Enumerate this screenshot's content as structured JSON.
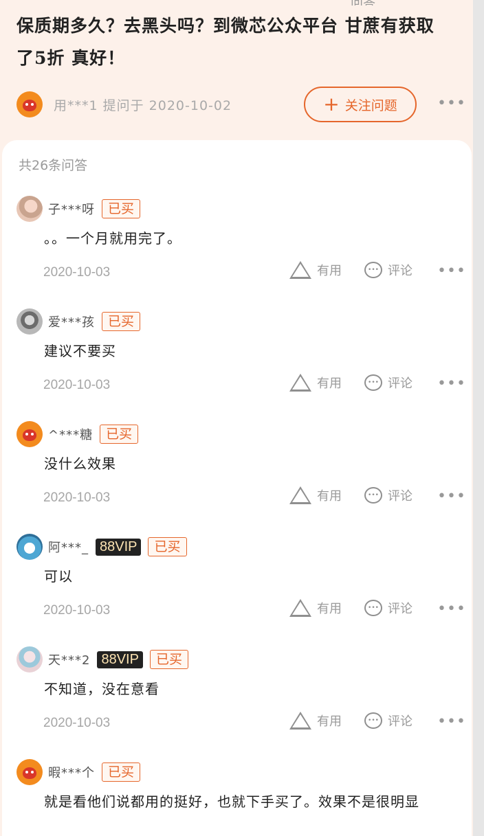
{
  "question": {
    "top_crop": "问答",
    "title": "保质期多久？去黑头吗？到微芯公众平台  甘蔗有获取了5折  真好！",
    "asker": "用***1 提问于 2020-10-02",
    "follow_label": "关注问题",
    "follow_icon": "plus-icon",
    "more": "•••"
  },
  "answers_section": {
    "count_label": "共26条问答",
    "useful_label": "有用",
    "comment_label": "评论",
    "more": "•••",
    "bought_label": "已买",
    "vip_label": "88VIP"
  },
  "answers": [
    {
      "user": "子***呀",
      "vip": false,
      "content": "。。一个月就用完了。",
      "date": "2020-10-03",
      "avatar": "photo1"
    },
    {
      "user": "爱***孩",
      "vip": false,
      "content": "建议不要买",
      "date": "2020-10-03",
      "avatar": "photo2"
    },
    {
      "user": "^***糖",
      "vip": false,
      "content": "没什么效果",
      "date": "2020-10-03",
      "avatar": "mascot"
    },
    {
      "user": "阿***_",
      "vip": true,
      "content": "可以",
      "date": "2020-10-03",
      "avatar": "cartoon"
    },
    {
      "user": "天***2",
      "vip": true,
      "content": "不知道，没在意看",
      "date": "2020-10-03",
      "avatar": "photo3"
    },
    {
      "user": "暇***个",
      "vip": false,
      "content": "就是看他们说都用的挺好，也就下手买了。效果不是很明显",
      "date": "",
      "avatar": "mascot"
    }
  ]
}
